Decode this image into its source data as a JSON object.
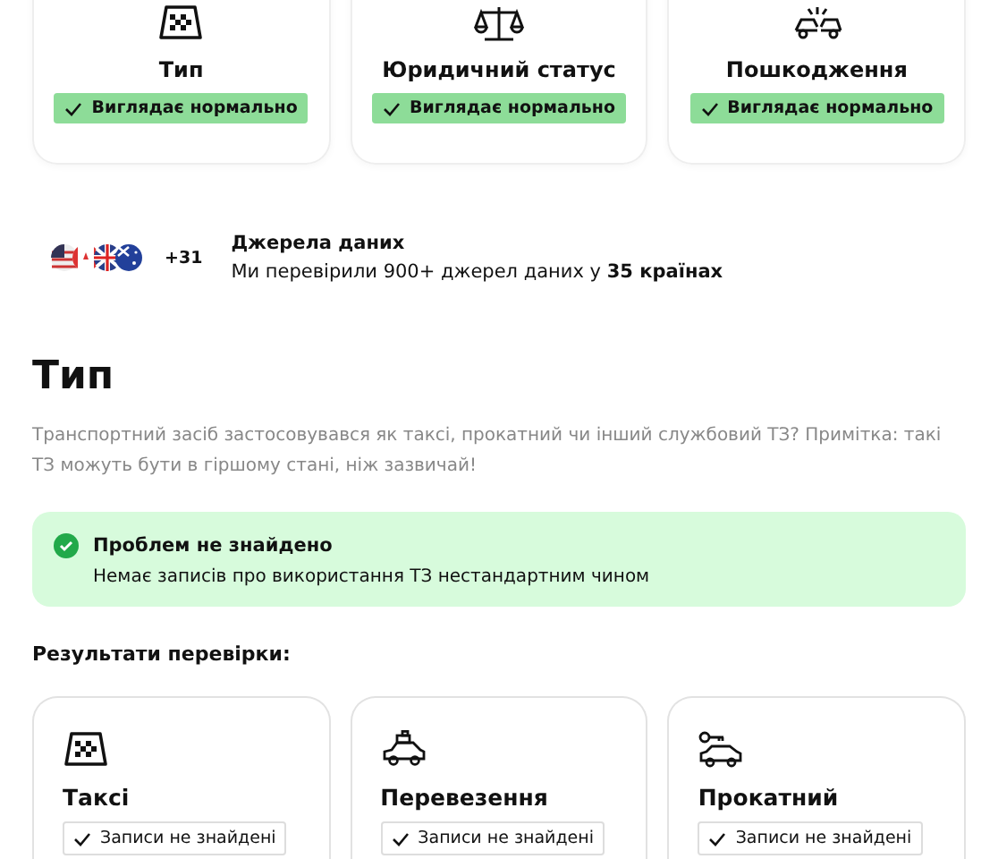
{
  "checks": [
    {
      "kind": "taxi",
      "title": "Тип",
      "badge": "Виглядає нормально"
    },
    {
      "kind": "scales",
      "title": "Юридичний статус",
      "badge": "Виглядає нормально"
    },
    {
      "kind": "damage",
      "title": "Пошкодження",
      "badge": "Виглядає нормально"
    }
  ],
  "sources": {
    "more": "+31",
    "title": "Джерела даних",
    "text": "Ми перевірили 900+ джерел даних у **35 країнах**"
  },
  "section": {
    "heading": "Тип",
    "description": "Транспортний засіб застосовувався як таксі, прокатний чи інший службовий ТЗ? Примітка: такі ТЗ можуть бути в гіршому стані, ніж зазвичай!",
    "alert": {
      "title": "Проблем не знайдено",
      "text": "Немає записів про використання ТЗ нестандартним чином"
    },
    "results_title": "Результати перевірки:",
    "results": [
      {
        "kind": "taxi",
        "title": "Таксі",
        "badge": "Записи не знайдені"
      },
      {
        "kind": "cargo",
        "title": "Перевезення",
        "badge": "Записи не знайдені"
      },
      {
        "kind": "rental",
        "title": "Прокатний",
        "badge": "Записи не знайдені"
      }
    ]
  }
}
